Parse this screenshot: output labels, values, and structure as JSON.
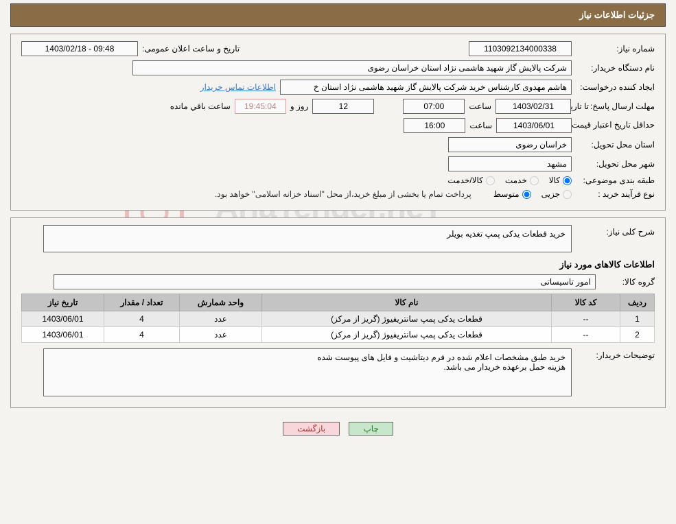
{
  "header": {
    "title": "جزئیات اطلاعات نیاز"
  },
  "need": {
    "number_label": "شماره نیاز:",
    "number": "1103092134000338",
    "announce_label": "تاریخ و ساعت اعلان عمومی:",
    "announce": "1403/02/18 - 09:48",
    "buyer_org_label": "نام دستگاه خریدار:",
    "buyer_org": "شرکت پالایش گاز شهید هاشمی نژاد   استان خراسان رضوی",
    "creator_label": "ایجاد کننده درخواست:",
    "creator": "هاشم مهدوی کارشناس خرید شرکت پالایش گاز شهید هاشمی نژاد   استان خ",
    "contact_link": "اطلاعات تماس خریدار",
    "deadline_label": "مهلت ارسال پاسخ:",
    "to_date_label": "تا تاریخ:",
    "deadline_date": "1403/02/31",
    "time_label": "ساعت",
    "deadline_time": "07:00",
    "days": "12",
    "days_and": "روز و",
    "countdown": "19:45:04",
    "remaining": "ساعت باقي مانده",
    "validity_label": "حداقل تاریخ اعتبار قیمت:",
    "validity_date": "1403/06/01",
    "validity_time": "16:00",
    "province_label": "استان محل تحویل:",
    "province": "خراسان رضوی",
    "city_label": "شهر محل تحویل:",
    "city": "مشهد",
    "category_label": "طبقه بندی موضوعی:",
    "cat_goods": "کالا",
    "cat_service": "خدمت",
    "cat_both": "کالا/خدمت",
    "purchase_type_label": "نوع فرآیند خرید :",
    "type_minor": "جزیی",
    "type_medium": "متوسط",
    "purchase_note": "پرداخت تمام یا بخشی از مبلغ خرید،از محل \"اسناد خزانه اسلامی\" خواهد بود."
  },
  "desc": {
    "overview_label": "شرح کلی نیاز:",
    "overview": "خرید قطعات یدکی پمپ تغذیه بویلر",
    "goods_info_title": "اطلاعات کالاهای مورد نیاز",
    "group_label": "گروه کالا:",
    "group": "امور تاسیساتی"
  },
  "table": {
    "headers": {
      "row": "ردیف",
      "code": "کد کالا",
      "name": "نام کالا",
      "unit": "واحد شمارش",
      "qty": "تعداد / مقدار",
      "date": "تاریخ نیاز"
    },
    "rows": [
      {
        "idx": "1",
        "code": "--",
        "name": "قطعات یدکی پمپ سانتریفیوژ (گریز از مرکز)",
        "unit": "عدد",
        "qty": "4",
        "date": "1403/06/01"
      },
      {
        "idx": "2",
        "code": "--",
        "name": "قطعات یدکی پمپ سانتریفیوژ (گریز از مرکز)",
        "unit": "عدد",
        "qty": "4",
        "date": "1403/06/01"
      }
    ]
  },
  "buyer_desc": {
    "label": "توضیحات خریدار:",
    "text": "خرید طبق مشخصات اعلام شده در فرم دیتاشیت و فایل های پیوست شده\nهزینه حمل برعهده خریدار می باشد."
  },
  "buttons": {
    "print": "چاپ",
    "back": "بازگشت"
  },
  "watermark": "AriaTender.neT"
}
